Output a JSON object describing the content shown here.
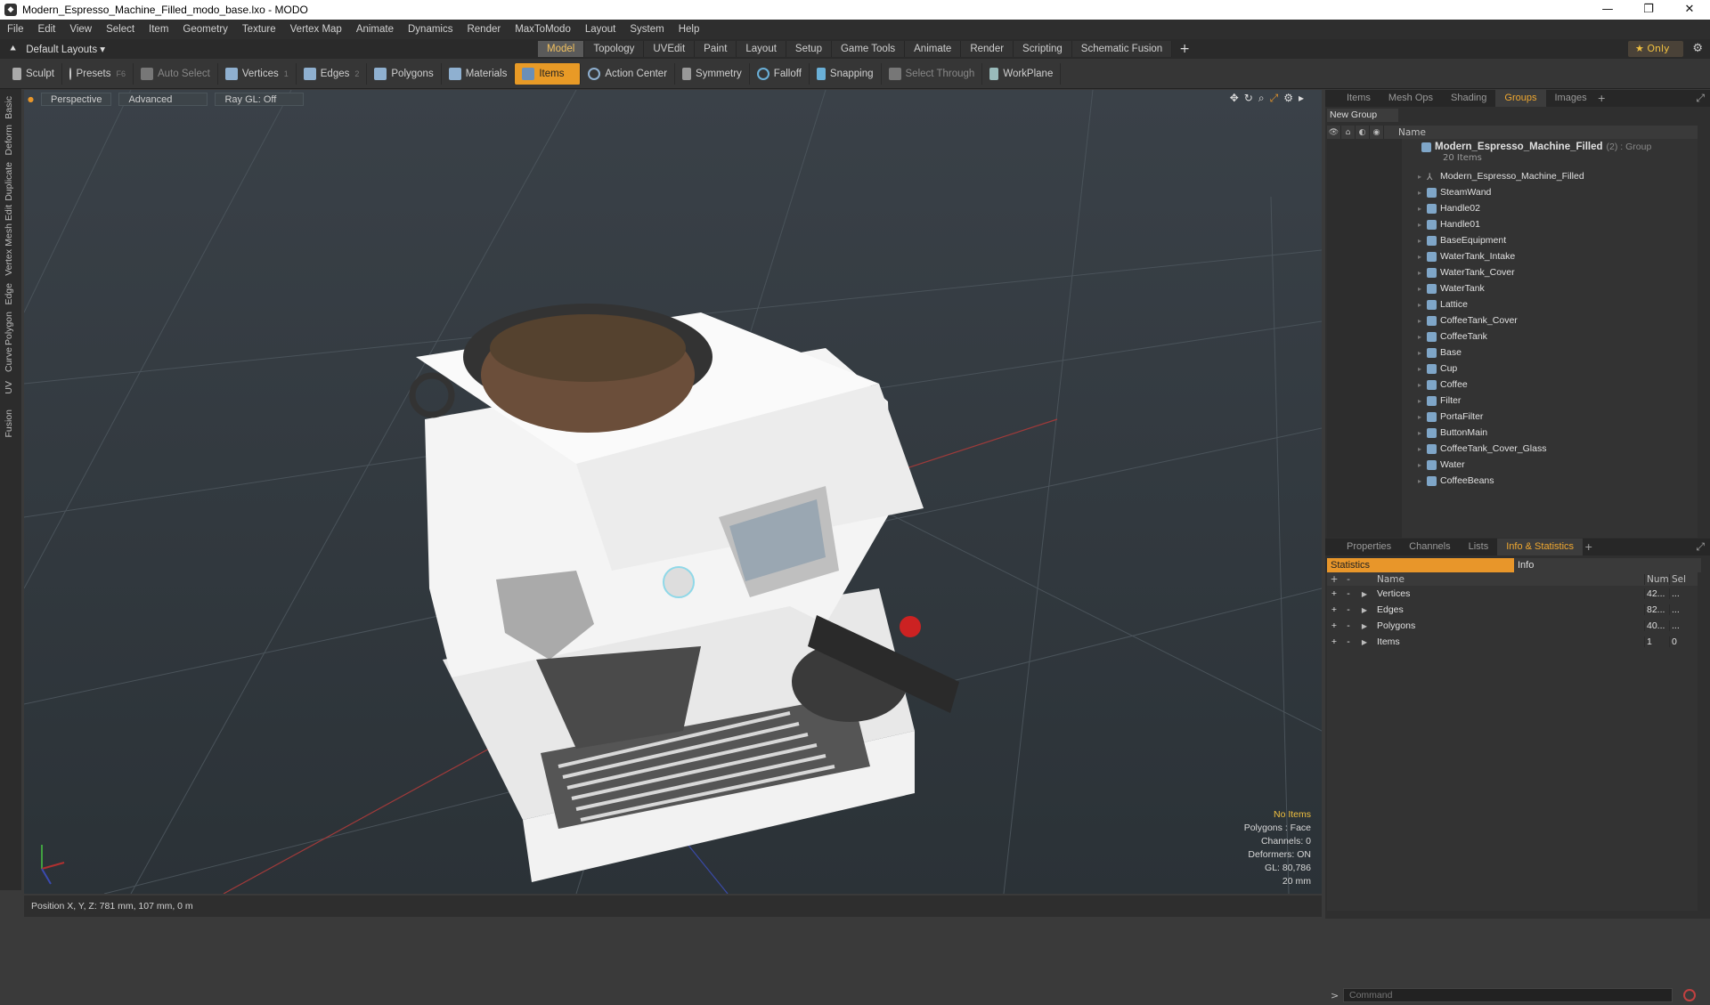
{
  "window": {
    "title": "Modern_Espresso_Machine_Filled_modo_base.lxo - MODO"
  },
  "menu": [
    "File",
    "Edit",
    "View",
    "Select",
    "Item",
    "Geometry",
    "Texture",
    "Vertex Map",
    "Animate",
    "Dynamics",
    "Render",
    "MaxToModo",
    "Layout",
    "System",
    "Help"
  ],
  "layout_selector": "Default Layouts ▾",
  "mode_tabs": [
    "Model",
    "Topology",
    "UVEdit",
    "Paint",
    "Layout",
    "Setup",
    "Game Tools",
    "Animate",
    "Render",
    "Scripting",
    "Schematic Fusion"
  ],
  "mode_active": "Model",
  "only_label": "Only",
  "toolbar": {
    "sculpt": "Sculpt",
    "presets": "Presets",
    "presets_key": "F6",
    "auto_select": "Auto Select",
    "vertices": "Vertices",
    "vertices_key": "1",
    "edges": "Edges",
    "edges_key": "2",
    "polygons": "Polygons",
    "materials": "Materials",
    "items": "Items",
    "action_center": "Action Center",
    "symmetry": "Symmetry",
    "falloff": "Falloff",
    "snapping": "Snapping",
    "select_through": "Select Through",
    "workplane": "WorkPlane"
  },
  "left_tabs": [
    "Basic",
    "Deform",
    "Duplicate",
    "Mesh Edit",
    "Vertex",
    "Edge",
    "Polygon",
    "Curve",
    "UV",
    "Fusion"
  ],
  "viewport": {
    "perspective": "Perspective",
    "advanced": "Advanced",
    "raygl": "Ray GL: Off",
    "info": [
      "No Items",
      "Polygons : Face",
      "Channels: 0",
      "Deformers: ON",
      "GL: 80,786",
      "20 mm"
    ]
  },
  "status": {
    "position": "Position X, Y, Z:   781 mm, 107 mm, 0 m"
  },
  "right_top_tabs": [
    "Items",
    "Mesh Ops",
    "Shading",
    "Groups",
    "Images"
  ],
  "right_top_active": "Groups",
  "new_group": "New Group",
  "groups_header": "Name",
  "group": {
    "name": "Modern_Espresso_Machine_Filled",
    "count": "(2) : Group",
    "sub": "20 Items",
    "items": [
      "Modern_Espresso_Machine_Filled",
      "SteamWand",
      "Handle02",
      "Handle01",
      "BaseEquipment",
      "WaterTank_Intake",
      "WaterTank_Cover",
      "WaterTank",
      "Lattice",
      "CoffeeTank_Cover",
      "CoffeeTank",
      "Base",
      "Cup",
      "Coffee",
      "Filter",
      "PortaFilter",
      "ButtonMain",
      "CoffeeTank_Cover_Glass",
      "Water",
      "CoffeeBeans"
    ]
  },
  "right_bottom_tabs": [
    "Properties",
    "Channels",
    "Lists",
    "Info & Statistics"
  ],
  "right_bottom_active": "Info & Statistics",
  "stats_tabs": {
    "statistics": "Statistics",
    "info": "Info"
  },
  "stats_header": {
    "name": "Name",
    "num": "Num",
    "sel": "Sel"
  },
  "stats_rows": [
    {
      "name": "Vertices",
      "num": "42...",
      "sel": "..."
    },
    {
      "name": "Edges",
      "num": "82...",
      "sel": "..."
    },
    {
      "name": "Polygons",
      "num": "40...",
      "sel": "..."
    },
    {
      "name": "Items",
      "num": "1",
      "sel": "0"
    }
  ],
  "command_placeholder": "Command",
  "colors": {
    "accent": "#e8962a",
    "viewport_bg": "#343b41",
    "selected_text": "#f0c040"
  }
}
